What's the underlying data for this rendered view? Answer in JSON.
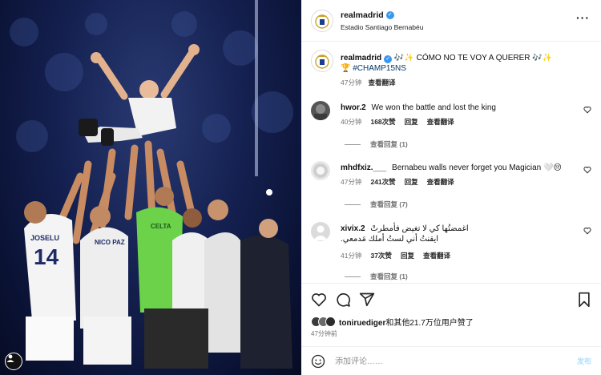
{
  "post": {
    "username": "realmadrid",
    "location": "Estadio Santiago Bernabéu",
    "caption": {
      "username": "realmadrid",
      "text": "🎶✨ CÓMO NO TE VOY A QUERER 🎶✨",
      "hashtag": "🏆 #CHAMP15NS",
      "time": "47分钟",
      "translate": "查看翻译"
    }
  },
  "comments": [
    {
      "username": "hwor.2",
      "text": "We won the battle and lost the king",
      "time": "40分钟",
      "likes": "168次赞",
      "reply": "回复",
      "translate": "查看翻译",
      "view_replies": "查看回复 (1)"
    },
    {
      "username": "mhdfxiz.___",
      "text": "Bernabeu walls never forget you Magician 🤍😔",
      "time": "47分钟",
      "likes": "241次赞",
      "reply": "回复",
      "translate": "查看翻译",
      "view_replies": "查看回复 (7)"
    },
    {
      "username": "xivix.2",
      "text": "اغمضتُها كي لا تغيض فأمطرتْ\nايقنتُ أني لستُ أملك مَدمعي.",
      "time": "41分钟",
      "likes": "37次赞",
      "reply": "回复",
      "translate": "查看翻译",
      "view_replies": "查看回复 (1)"
    }
  ],
  "likes_line": {
    "user": "toniruediger",
    "rest": "和其他21.7万位用户赞了"
  },
  "time_ago": "47分钟前",
  "comment_box": {
    "placeholder": "添加评论……",
    "post_label": "发布"
  },
  "icons": {
    "verified": "verified-badge-icon",
    "more": "more-options-icon",
    "heart": "heart-icon",
    "comment": "comment-icon",
    "share": "share-icon",
    "save": "bookmark-icon",
    "emoji": "emoji-icon",
    "user_tag": "user-tag-icon"
  },
  "colors": {
    "verified_blue": "#3897f0",
    "hashtag": "#00376b",
    "meta_gray": "#737373",
    "post_disabled": "#b2dffc"
  }
}
